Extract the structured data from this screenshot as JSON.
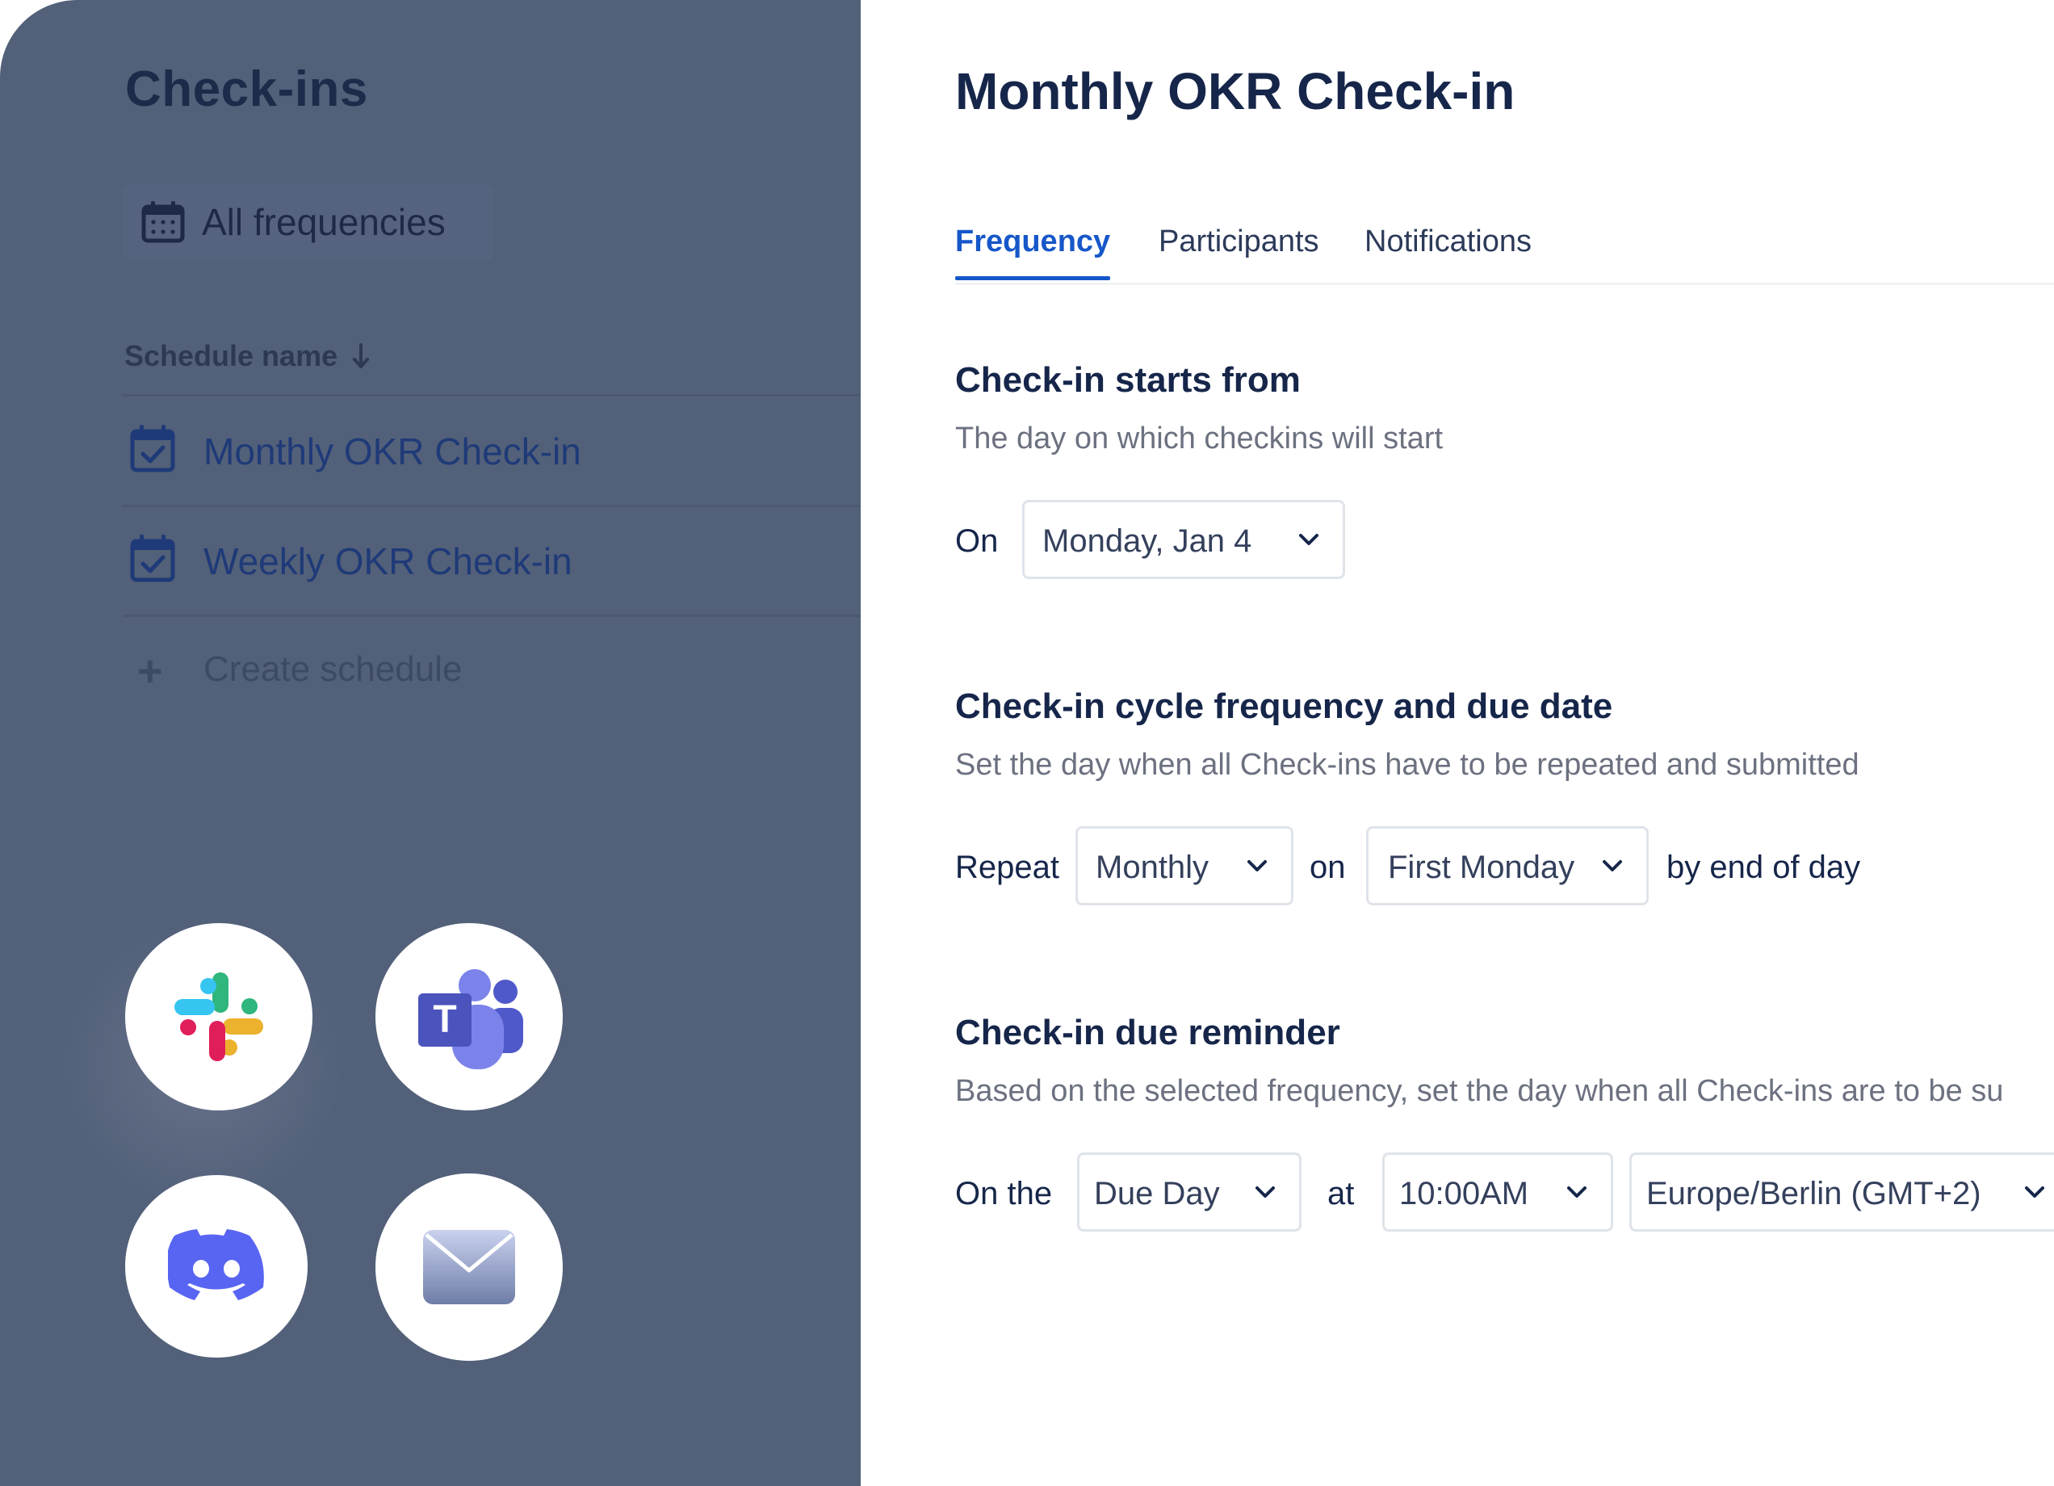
{
  "sidebar": {
    "title": "Check-ins",
    "filter_label": "All frequencies",
    "column_header": "Schedule name",
    "sort_icon": "arrow-down-icon",
    "schedules": [
      {
        "label": "Monthly OKR Check-in",
        "icon": "calendar-check-icon"
      },
      {
        "label": "Weekly OKR Check-in",
        "icon": "calendar-check-icon"
      }
    ],
    "create_label": "Create schedule",
    "integrations": [
      "slack-icon",
      "teams-icon",
      "discord-icon",
      "mail-icon"
    ]
  },
  "main": {
    "title": "Monthly OKR Check-in",
    "tabs": [
      {
        "label": "Frequency",
        "active": true
      },
      {
        "label": "Participants",
        "active": false
      },
      {
        "label": "Notifications",
        "active": false
      }
    ],
    "start": {
      "title": "Check-in starts from",
      "description": "The day on which checkins will start",
      "on_label": "On",
      "date_value": "Monday, Jan 4"
    },
    "cycle": {
      "title": "Check-in cycle frequency and due date",
      "description": "Set the day when all Check-ins have to be repeated and submitted",
      "repeat_label": "Repeat",
      "repeat_value": "Monthly",
      "on_label": "on",
      "day_value": "First Monday",
      "suffix": "by end of day"
    },
    "reminder": {
      "title": "Check-in due reminder",
      "description": "Based on the selected frequency, set the day when all Check-ins are to be su",
      "on_the_label": "On the",
      "day_value": "Due Day",
      "at_label": "at",
      "time_value": "10:00AM",
      "timezone_value": "Europe/Berlin (GMT+2)"
    }
  },
  "colors": {
    "sidebar_bg": "#526079",
    "accent": "#1657c9",
    "heading": "#16264a"
  }
}
